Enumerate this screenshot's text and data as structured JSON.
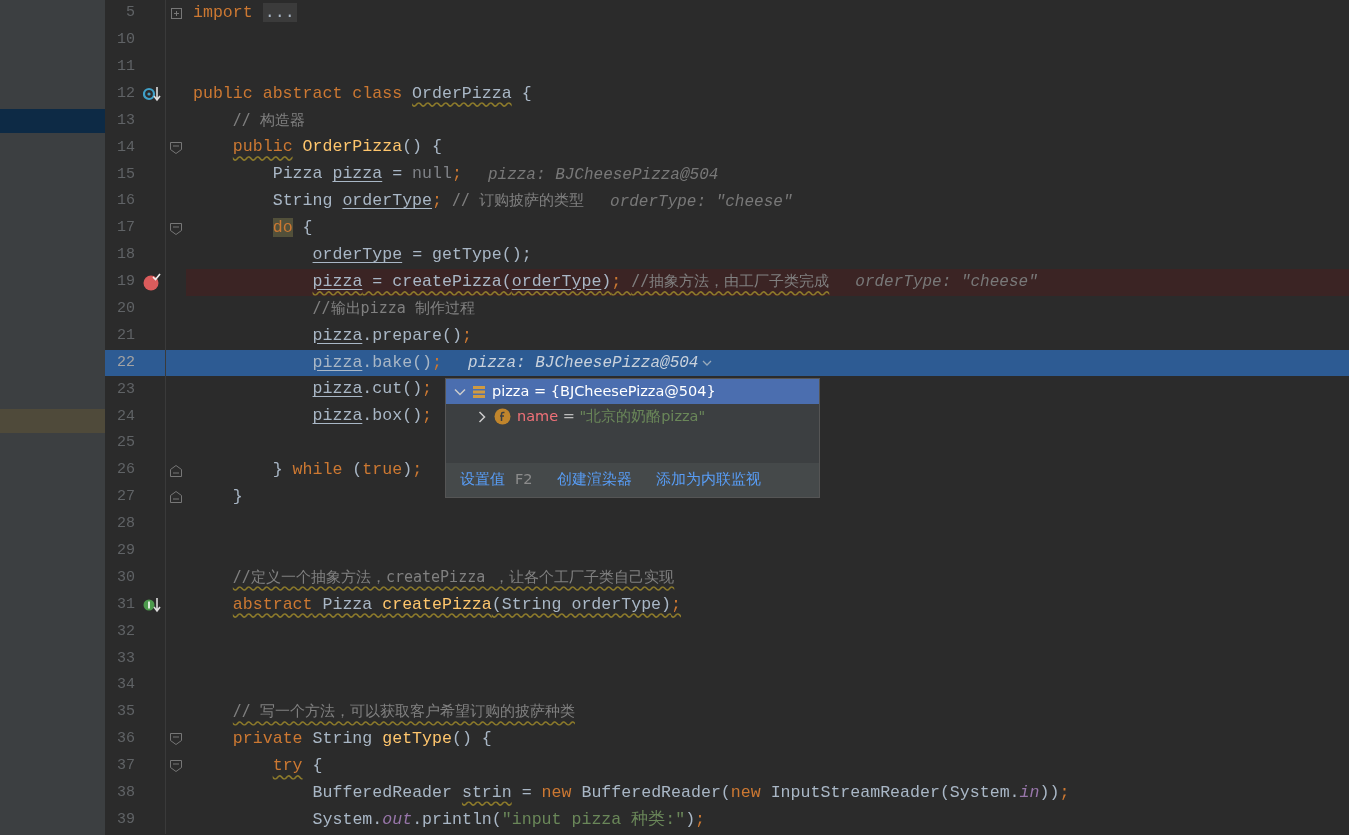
{
  "editor": {
    "lines": [
      {
        "number": "5",
        "fold": {
          "kind": "collapsed"
        },
        "tokens": [
          {
            "text": "import ",
            "kind": "kw"
          },
          {
            "text": "...",
            "kind": "folded"
          }
        ]
      },
      {
        "number": "10"
      },
      {
        "number": "11"
      },
      {
        "number": "12",
        "marker": {
          "kind": "implemented"
        },
        "tokens": [
          {
            "text": "public abstract class ",
            "kind": "kw"
          },
          {
            "text": "OrderPizza",
            "kind": "plain",
            "wavy": true
          },
          {
            "text": " {",
            "kind": "plain"
          }
        ],
        "children": [
          {
            "number": "13",
            "tokens": [
              {
                "text": "// 构造器",
                "kind": "cm"
              }
            ]
          },
          {
            "number": "14",
            "fold": {
              "kind": "start"
            },
            "tokens": [
              {
                "text": "public",
                "kind": "kw",
                "wavy": true
              },
              {
                "text": " OrderPizza",
                "kind": "fn"
              },
              {
                "text": "() {",
                "kind": "plain"
              }
            ],
            "children": [
              {
                "number": "15",
                "hint": "pizza: BJCheesePizza@504",
                "tokens": [
                  {
                    "text": "Pizza ",
                    "kind": "plain"
                  },
                  {
                    "text": "pizza",
                    "kind": "plain",
                    "underline": true
                  },
                  {
                    "text": " = ",
                    "kind": "plain"
                  },
                  {
                    "text": "null",
                    "kind": "muted"
                  },
                  {
                    "text": ";",
                    "kind": "kw"
                  }
                ]
              },
              {
                "number": "16",
                "hint": "orderType: \"cheese\"",
                "tokens": [
                  {
                    "text": "String ",
                    "kind": "plain"
                  },
                  {
                    "text": "orderType",
                    "kind": "plain",
                    "underline": true
                  },
                  {
                    "text": "; ",
                    "kind": "kw"
                  },
                  {
                    "text": "// 订购披萨的类型",
                    "kind": "cm"
                  }
                ]
              },
              {
                "number": "17",
                "fold": {
                  "kind": "start"
                },
                "tokens": [
                  {
                    "text": "do",
                    "kind": "kwhl"
                  },
                  {
                    "text": " {",
                    "kind": "plain"
                  }
                ],
                "children": [
                  {
                    "number": "18",
                    "tokens": [
                      {
                        "text": "orderType",
                        "kind": "plain",
                        "underline": true
                      },
                      {
                        "text": " = getType();",
                        "kind": "plain"
                      }
                    ]
                  },
                  {
                    "number": "19",
                    "kind": "breakpoint",
                    "warning": true,
                    "marker": {
                      "kind": "breakpoint"
                    },
                    "hint": "orderType: \"cheese\"",
                    "tokens": [
                      {
                        "text": "pizza",
                        "kind": "plain",
                        "underline": true
                      },
                      {
                        "text": " = createPizza(",
                        "kind": "plain"
                      },
                      {
                        "text": "orderType",
                        "kind": "plain",
                        "underline": true
                      },
                      {
                        "text": ")",
                        "kind": "plain"
                      },
                      {
                        "text": "; ",
                        "kind": "kw"
                      },
                      {
                        "text": "//抽象方法，由工厂子类完成",
                        "kind": "cm"
                      }
                    ]
                  },
                  {
                    "number": "20",
                    "tokens": [
                      {
                        "text": "//输出pizza 制作过程",
                        "kind": "cm"
                      }
                    ]
                  },
                  {
                    "number": "21",
                    "tokens": [
                      {
                        "text": "pizza",
                        "kind": "plain",
                        "underline": true
                      },
                      {
                        "text": ".prepare()",
                        "kind": "plain"
                      },
                      {
                        "text": ";",
                        "kind": "kw"
                      }
                    ]
                  },
                  {
                    "number": "22",
                    "kind": "current",
                    "hint": "pizza: BJCheesePizza@504",
                    "hint_expandable": true,
                    "tokens": [
                      {
                        "text": "pizza",
                        "kind": "plain",
                        "underline": true
                      },
                      {
                        "text": ".bake()",
                        "kind": "plain"
                      },
                      {
                        "text": ";",
                        "kind": "kw"
                      }
                    ]
                  },
                  {
                    "number": "23",
                    "tokens": [
                      {
                        "text": "pizza",
                        "kind": "plain",
                        "underline": true
                      },
                      {
                        "text": ".cut()",
                        "kind": "plain"
                      },
                      {
                        "text": ";",
                        "kind": "kw"
                      }
                    ]
                  },
                  {
                    "number": "24",
                    "tokens": [
                      {
                        "text": "pizza",
                        "kind": "plain",
                        "underline": true
                      },
                      {
                        "text": ".box()",
                        "kind": "plain"
                      },
                      {
                        "text": ";",
                        "kind": "kw"
                      }
                    ]
                  },
                  {
                    "number": "25"
                  }
                ]
              },
              {
                "number": "26",
                "fold": {
                  "kind": "end"
                },
                "tokens": [
                  {
                    "text": "} ",
                    "kind": "plain"
                  },
                  {
                    "text": "while",
                    "kind": "kw"
                  },
                  {
                    "text": " (",
                    "kind": "plain"
                  },
                  {
                    "text": "true",
                    "kind": "kw"
                  },
                  {
                    "text": ")",
                    "kind": "plain"
                  },
                  {
                    "text": ";",
                    "kind": "kw"
                  }
                ]
              }
            ]
          },
          {
            "number": "27",
            "fold": {
              "kind": "end"
            },
            "tokens": [
              {
                "text": "}",
                "kind": "plain"
              }
            ]
          },
          {
            "number": "28"
          },
          {
            "number": "29"
          },
          {
            "number": "30",
            "tokens": [
              {
                "text": "//定义一个抽象方法，createPizza ，让各个工厂子类自己实现",
                "kind": "cm",
                "wavy": true
              }
            ]
          },
          {
            "number": "31",
            "warning": true,
            "marker": {
              "kind": "implementing"
            },
            "tokens": [
              {
                "text": "abstract",
                "kind": "kw"
              },
              {
                "text": " Pizza ",
                "kind": "plain"
              },
              {
                "text": "createPizza",
                "kind": "fn"
              },
              {
                "text": "(String orderType)",
                "kind": "plain"
              },
              {
                "text": ";",
                "kind": "kw"
              }
            ]
          },
          {
            "number": "32"
          },
          {
            "number": "33"
          },
          {
            "number": "34"
          },
          {
            "number": "35",
            "tokens": [
              {
                "text": "// 写一个方法，可以获取客户希望订购的披萨种类",
                "kind": "cm",
                "wavy": true
              }
            ]
          },
          {
            "number": "36",
            "fold": {
              "kind": "start"
            },
            "tokens": [
              {
                "text": "private",
                "kind": "kw"
              },
              {
                "text": " String ",
                "kind": "plain"
              },
              {
                "text": "getType",
                "kind": "fn"
              },
              {
                "text": "() {",
                "kind": "plain"
              }
            ],
            "children": [
              {
                "number": "37",
                "fold": {
                  "kind": "start"
                },
                "tokens": [
                  {
                    "text": "try",
                    "kind": "kw",
                    "wavy": true
                  },
                  {
                    "text": " {",
                    "kind": "plain"
                  }
                ],
                "children": [
                  {
                    "number": "38",
                    "tokens": [
                      {
                        "text": "BufferedReader ",
                        "kind": "plain"
                      },
                      {
                        "text": "strin",
                        "kind": "plain",
                        "wavy": true
                      },
                      {
                        "text": " = ",
                        "kind": "plain"
                      },
                      {
                        "text": "new",
                        "kind": "kw"
                      },
                      {
                        "text": " BufferedReader(",
                        "kind": "plain"
                      },
                      {
                        "text": "new",
                        "kind": "kw"
                      },
                      {
                        "text": " InputStreamReader(System.",
                        "kind": "plain"
                      },
                      {
                        "text": "in",
                        "kind": "static"
                      },
                      {
                        "text": "))",
                        "kind": "plain"
                      },
                      {
                        "text": ";",
                        "kind": "kw"
                      }
                    ]
                  },
                  {
                    "number": "39",
                    "tokens": [
                      {
                        "text": "System.",
                        "kind": "plain"
                      },
                      {
                        "text": "out",
                        "kind": "static"
                      },
                      {
                        "text": ".println(",
                        "kind": "plain"
                      },
                      {
                        "text": "\"input pizza 种类:\"",
                        "kind": "str"
                      },
                      {
                        "text": ")",
                        "kind": "plain"
                      },
                      {
                        "text": ";",
                        "kind": "kw"
                      }
                    ]
                  }
                ]
              }
            ]
          }
        ]
      }
    ]
  },
  "debug_popup": {
    "tree": [
      {
        "name": "pizza",
        "operator": "=",
        "value": "{BJCheesePizza@504}",
        "kind": "object",
        "expanded": true,
        "selected": true,
        "children": [
          {
            "name": "name",
            "operator": "=",
            "value": "\"北京的奶酪pizza\"",
            "kind": "field",
            "expanded": false,
            "selected": false
          }
        ]
      }
    ],
    "actions": [
      {
        "label": "设置值",
        "shortcut": "F2"
      },
      {
        "label": "创建渲染器"
      },
      {
        "label": "添加为内联监视"
      }
    ]
  }
}
